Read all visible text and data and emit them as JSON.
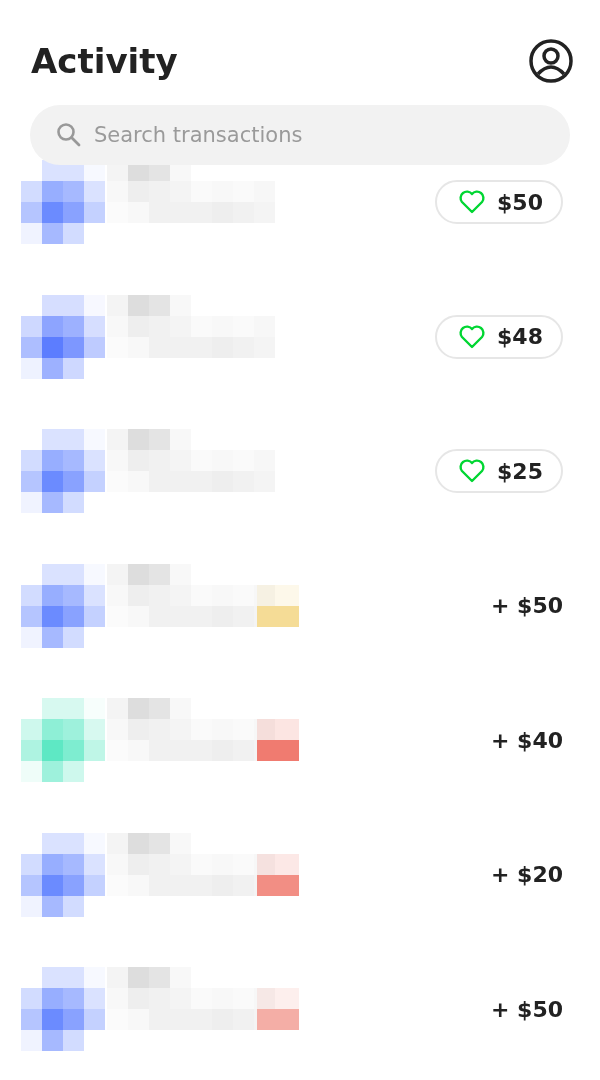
{
  "header": {
    "title": "Activity"
  },
  "search": {
    "placeholder": "Search transactions"
  },
  "transactions": [
    {
      "kind": "tip",
      "amount": "$50",
      "color": "#6b8bff"
    },
    {
      "kind": "tip",
      "amount": "$48",
      "color": "#5c7dff"
    },
    {
      "kind": "tip",
      "amount": "$25",
      "color": "#6b8bff"
    },
    {
      "kind": "received",
      "amount": "+ $50",
      "color": "#6b8bff",
      "tag": {
        "color": "#f5dc96"
      }
    },
    {
      "kind": "received",
      "amount": "+ $40",
      "color": "#5ee8c4",
      "tag": {
        "color": "#f07b70"
      }
    },
    {
      "kind": "received",
      "amount": "+ $20",
      "color": "#6b8bff",
      "tag": {
        "color": "#f28e84"
      }
    },
    {
      "kind": "received",
      "amount": "+ $50",
      "color": "#6b8bff",
      "tag": {
        "color": "#f4aea6"
      }
    }
  ]
}
